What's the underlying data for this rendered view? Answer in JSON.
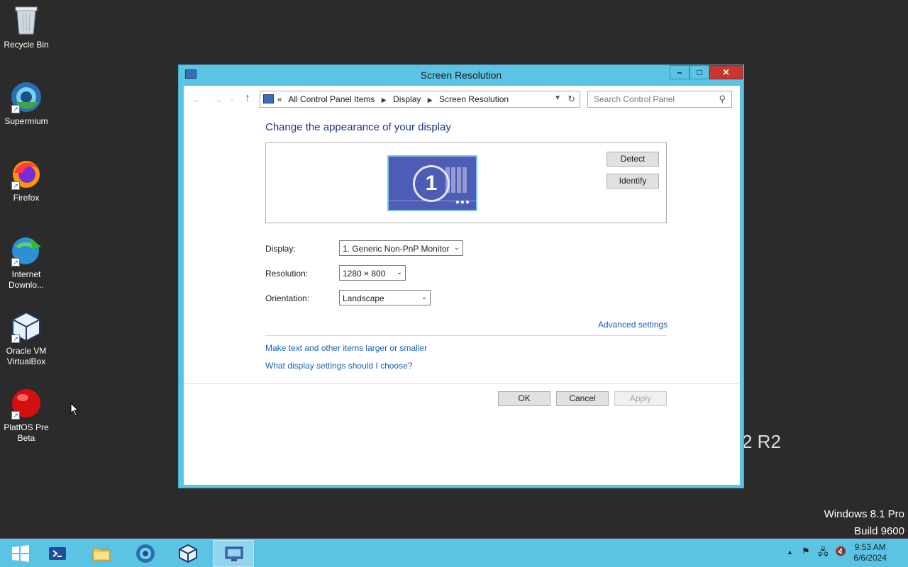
{
  "desktop": {
    "icons": [
      {
        "label": "Recycle Bin",
        "icon": "recycle-bin-icon"
      },
      {
        "label": "Supermium",
        "icon": "supermium-icon"
      },
      {
        "label": "Firefox",
        "icon": "firefox-icon"
      },
      {
        "label": "Internet Downlo...",
        "icon": "internet-download-manager-icon"
      },
      {
        "label": "Oracle VM VirtualBox",
        "icon": "virtualbox-icon"
      },
      {
        "label": "PlatfOS Pre Beta",
        "icon": "platfos-icon"
      }
    ],
    "watermark_edition": "Windows 8.1 Pro",
    "watermark_build": "Build 9600",
    "background_text": "2 R2"
  },
  "window": {
    "title": "Screen Resolution",
    "breadcrumb": [
      "All Control Panel Items",
      "Display",
      "Screen Resolution"
    ],
    "breadcrumb_prefix": "«",
    "search_placeholder": "Search Control Panel",
    "heading": "Change the appearance of your display",
    "monitor_number": "1",
    "detect_label": "Detect",
    "identify_label": "Identify",
    "display_label": "Display:",
    "display_value": "1. Generic Non-PnP Monitor",
    "resolution_label": "Resolution:",
    "resolution_value": "1280 × 800",
    "orientation_label": "Orientation:",
    "orientation_value": "Landscape",
    "advanced_settings": "Advanced settings",
    "link_larger": "Make text and other items larger or smaller",
    "link_choose": "What display settings should I choose?",
    "ok_label": "OK",
    "cancel_label": "Cancel",
    "apply_label": "Apply"
  },
  "taskbar": {
    "clock_time": "9:53 AM",
    "clock_date": "6/6/2024"
  },
  "colors": {
    "accent": "#5bc3e3",
    "close": "#c7362f",
    "link": "#1a5fb4",
    "heading": "#1e3287"
  }
}
